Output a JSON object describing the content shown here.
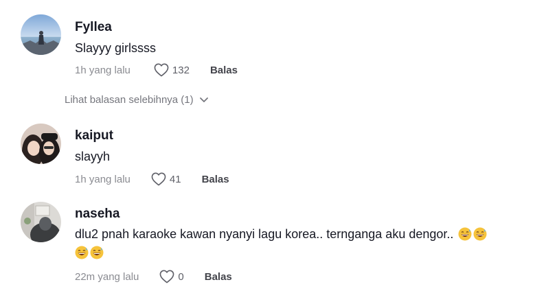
{
  "comments": [
    {
      "username": "Fyllea",
      "text": "Slayyy girlssss",
      "time": "1h yang lalu",
      "likes": "132",
      "reply_label": "Balas",
      "avatar_icon": "avatar-sea-photo"
    },
    {
      "username": "kaiput",
      "text": "slayyh",
      "time": "1h yang lalu",
      "likes": "41",
      "reply_label": "Balas",
      "avatar_icon": "avatar-two-girls-photo"
    },
    {
      "username": "naseha",
      "text_line1": "dlu2 pnah karaoke kawan nyanyi lagu korea.. ternganga aku dengor..",
      "time": "22m yang lalu",
      "likes": "0",
      "reply_label": "Balas",
      "avatar_icon": "avatar-room-photo",
      "emoji": "grinning-sweat-emoji"
    }
  ],
  "more_replies": "Lihat balasan selebihnya (1)",
  "colors": {
    "text": "#161823",
    "muted": "#8a8b91",
    "reply": "#43444b"
  }
}
